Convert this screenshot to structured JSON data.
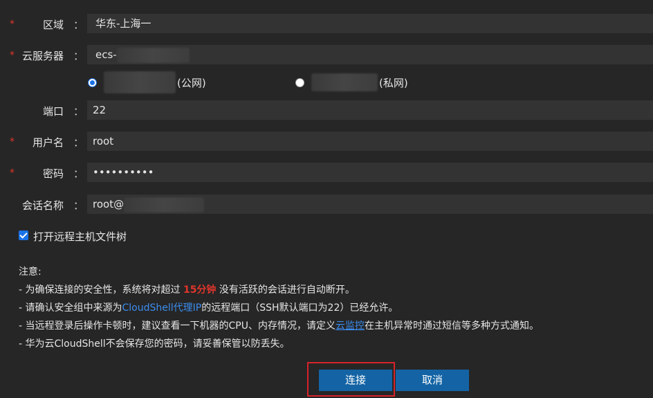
{
  "form": {
    "required_mark": "*",
    "colon": "：",
    "region": {
      "label": "区域",
      "value": "华东-上海一"
    },
    "server": {
      "label": "云服务器",
      "value_prefix": "ecs-",
      "public_suffix": "(公网)",
      "private_suffix": "(私网)",
      "selected": "public"
    },
    "port": {
      "label": "端口",
      "value": "22"
    },
    "username": {
      "label": "用户名",
      "value": "root"
    },
    "password": {
      "label": "密码",
      "value": "••••••••••"
    },
    "session_name": {
      "label": "会话名称",
      "value_prefix": "root@"
    },
    "open_file_tree": {
      "label": "打开远程主机文件树",
      "checked": true
    }
  },
  "notes": {
    "title": "注意:",
    "line1_a": "- 为确保连接的安全性，系统将对超过 ",
    "line1_highlight": "15分钟",
    "line1_b": " 没有活跃的会话进行自动断开。",
    "line2_a": "- 请确认安全组中来源为",
    "line2_link": "CloudShell代理IP",
    "line2_b": "的远程端口（SSH默认端口为22）已经允许。",
    "line3_a": "- 当远程登录后操作卡顿时，建议查看一下机器的CPU、内存情况，请定义",
    "line3_link": "云监控",
    "line3_b": "在主机异常时通过短信等多种方式通知。",
    "line4": "- 华为云CloudShell不会保存您的密码，请妥善保管以防丢失。"
  },
  "buttons": {
    "connect": "连接",
    "cancel": "取消"
  },
  "colors": {
    "background": "#262626",
    "field": "#333333",
    "primary": "#1464a5",
    "required": "#e0352b",
    "link": "#3b8df0",
    "highlight_box": "#d8232a"
  }
}
